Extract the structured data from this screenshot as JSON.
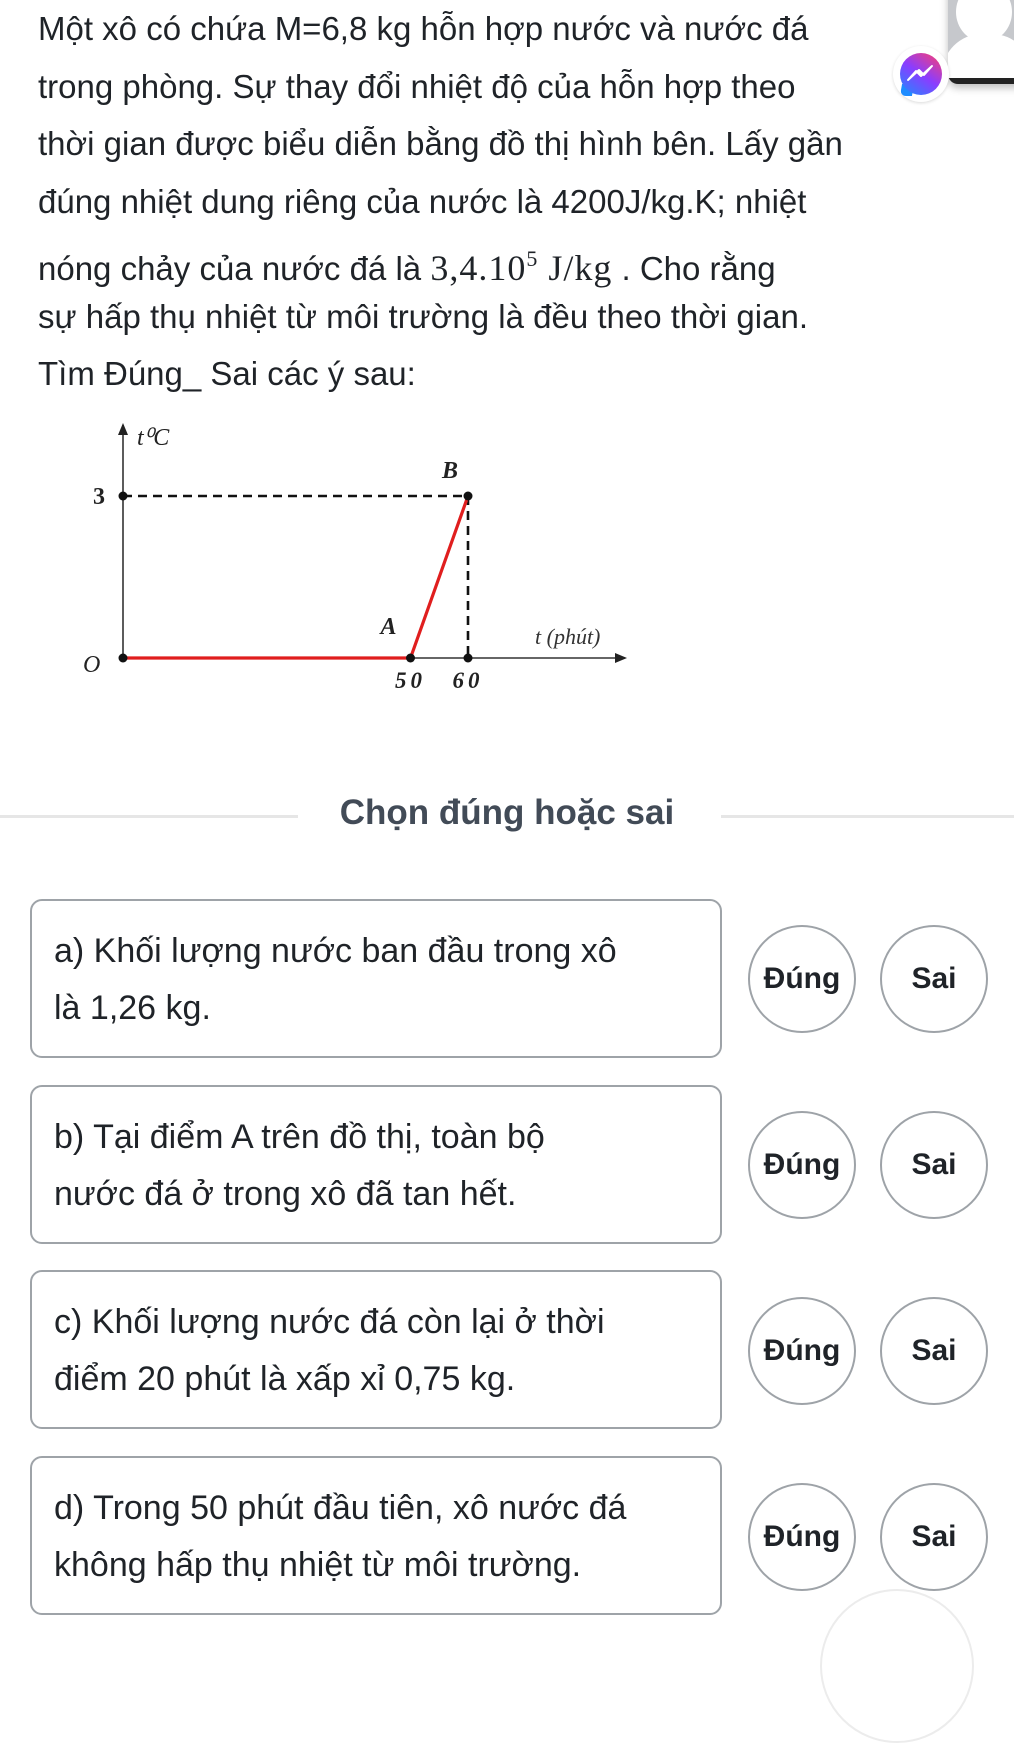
{
  "question": {
    "lines": [
      "Một xô có chứa M=6,8 kg hỗn hợp nước và nước đá",
      "trong phòng. Sự thay đổi nhiệt độ của hỗn hợp theo",
      "thời gian được biểu diễn bằng đồ thị hình bên. Lấy gần",
      "đúng nhiệt dung riêng của nước là 4200J/kg.K; nhiệt"
    ],
    "line5_prefix": "nóng chảy của nước đá là ",
    "line5_math_base": "3,4.10",
    "line5_math_exp": "5",
    "line5_math_unit": " J/kg",
    "line5_suffix": " . Cho rằng",
    "line6": "sự hấp thụ nhiệt từ môi trường là đều theo thời gian.",
    "line7": "Tìm Đúng_ Sai các ý sau:"
  },
  "chart_data": {
    "type": "line",
    "title": "",
    "xlabel": "t (phút)",
    "ylabel": "t⁰C",
    "origin_label": "O",
    "x_ticks": [
      "50",
      "60"
    ],
    "y_ticks": [
      "3"
    ],
    "xlim": [
      0,
      70
    ],
    "ylim": [
      0,
      4
    ],
    "series": [
      {
        "name": "temperature",
        "color": "#e01e1e",
        "points": [
          {
            "x": 0,
            "y": 0,
            "label": ""
          },
          {
            "x": 50,
            "y": 0,
            "label": "A"
          },
          {
            "x": 60,
            "y": 3,
            "label": "B"
          }
        ]
      }
    ],
    "guides": [
      {
        "from": {
          "x": 0,
          "y": 3
        },
        "to": {
          "x": 60,
          "y": 3
        },
        "style": "dashed"
      },
      {
        "from": {
          "x": 60,
          "y": 3
        },
        "to": {
          "x": 60,
          "y": 0
        },
        "style": "dashed"
      }
    ],
    "grid": false
  },
  "section": {
    "title": "Chọn đúng hoặc sai"
  },
  "items": [
    {
      "text_line1": "a) Khối lượng nước ban đầu trong xô",
      "text_line2": "là 1,26 kg.",
      "true_label": "Đúng",
      "false_label": "Sai"
    },
    {
      "text_line1": "b) Tại điểm A trên đồ thị, toàn bộ",
      "text_line2": "nước đá ở trong xô đã tan hết.",
      "true_label": "Đúng",
      "false_label": "Sai"
    },
    {
      "text_line1": "c) Khối lượng nước đá còn lại ở thời",
      "text_line2": "điểm 20 phút là xấp xỉ 0,75 kg.",
      "true_label": "Đúng",
      "false_label": "Sai"
    },
    {
      "text_line1": "d) Trong 50 phút đầu tiên, xô nước đá",
      "text_line2": "không hấp thụ nhiệt từ môi trường.",
      "true_label": "Đúng",
      "false_label": "Sai"
    }
  ],
  "overlay": {
    "messenger_icon": "messenger-icon",
    "chat_head_icon": "profile-avatar-icon"
  },
  "colors": {
    "text": "#1f2328",
    "heading": "#424b57",
    "border": "#9ea3a8",
    "chart_line": "#e01e1e"
  }
}
